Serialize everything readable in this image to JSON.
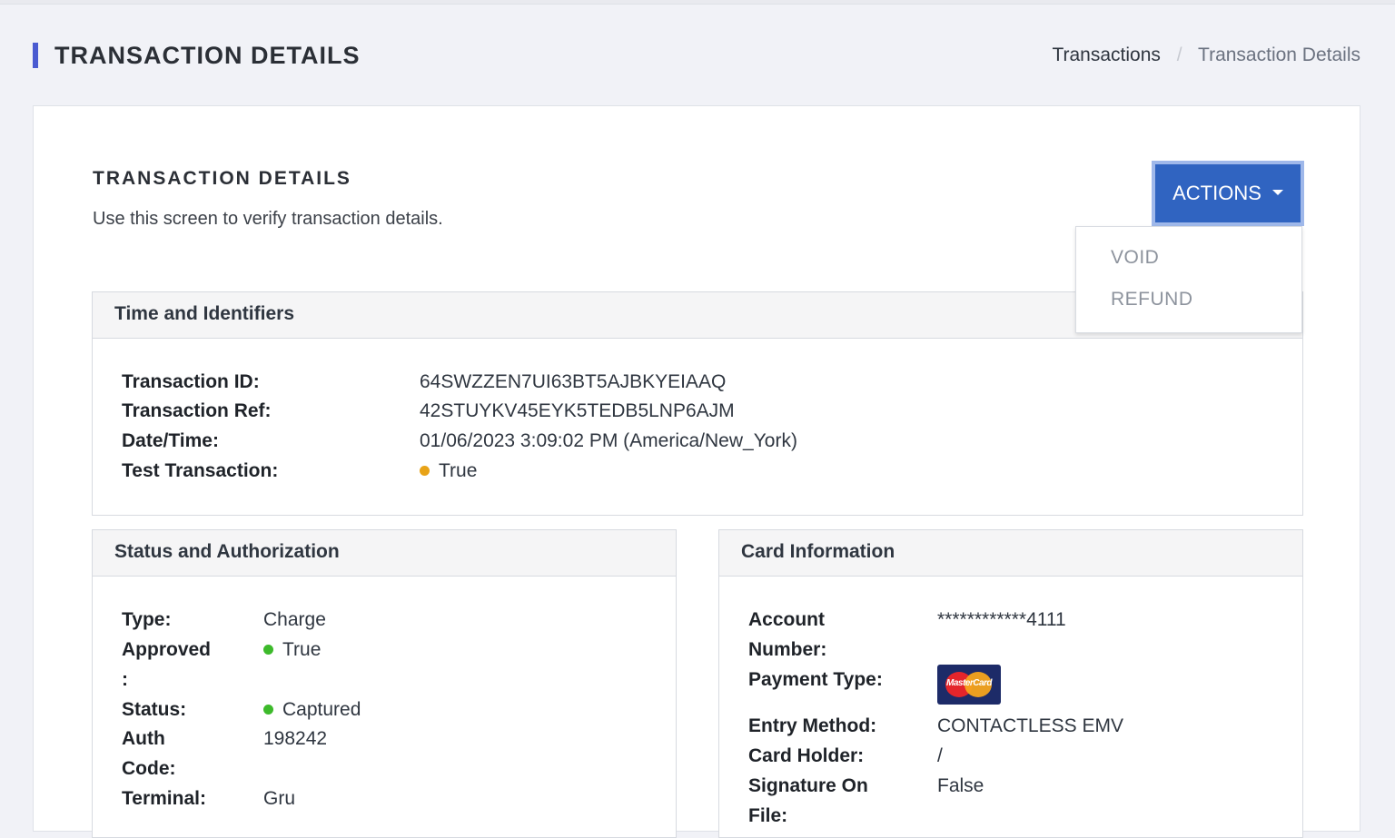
{
  "header": {
    "title": "TRANSACTION DETAILS",
    "breadcrumb": {
      "link": "Transactions",
      "separator": "/",
      "current": "Transaction Details"
    }
  },
  "content": {
    "title": "TRANSACTION DETAILS",
    "subtitle": "Use this screen to verify transaction details.",
    "actions_label": "ACTIONS",
    "actions_menu": [
      "VOID",
      "REFUND"
    ]
  },
  "time_panel": {
    "heading": "Time and Identifiers",
    "rows": [
      {
        "label": "Transaction ID:",
        "value": "64SWZZEN7UI63BT5AJBKYEIAAQ"
      },
      {
        "label": "Transaction Ref:",
        "value": "42STUYKV45EYK5TEDB5LNP6AJM"
      },
      {
        "label": "Date/Time:",
        "value": "01/06/2023 3:09:02 PM (America/New_York)"
      },
      {
        "label": "Test Transaction:",
        "value": "True",
        "status_color": "#e8a317"
      }
    ]
  },
  "status_panel": {
    "heading": "Status and Authorization",
    "rows": [
      {
        "label": "Type:",
        "value": "Charge"
      },
      {
        "label_line1": "Approved",
        "label_line2": ":",
        "value": "True",
        "status_color": "#3dba2b"
      },
      {
        "label": "Status:",
        "value": "Captured",
        "status_color": "#3dba2b"
      },
      {
        "label_line1": "Auth",
        "label_line2": "Code:",
        "value": "198242"
      },
      {
        "label": "Terminal:",
        "value": "Gru"
      }
    ]
  },
  "card_panel": {
    "heading": "Card Information",
    "rows": [
      {
        "label_line1": "Account",
        "label_line2": "Number:",
        "value": "************4111"
      },
      {
        "label": "Payment Type:",
        "value_icon": "mastercard-logo",
        "logo_text": "MasterCard"
      },
      {
        "label": "Entry Method:",
        "value": "CONTACTLESS EMV"
      },
      {
        "label": "Card Holder:",
        "value": "/"
      },
      {
        "label_line1": "Signature On",
        "label_line2": "File:",
        "value": "False"
      }
    ]
  },
  "colors": {
    "accent": "#4a5bd1",
    "button": "#3064c1",
    "warning": "#e8a317",
    "success": "#3dba2b"
  }
}
